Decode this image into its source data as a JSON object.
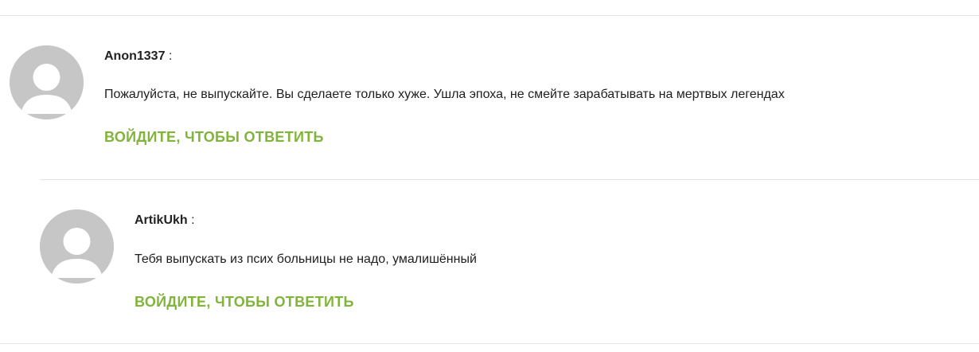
{
  "colors": {
    "accent": "#80b43a",
    "avatar_bg": "#c6c6c6",
    "divider": "#e4e4e4",
    "text": "#222222"
  },
  "comments": [
    {
      "author": "Anon1337",
      "separator": ":",
      "avatar_icon": "default-user-avatar-icon",
      "text": "Пожалуйста, не выпускайте. Вы сделаете только хуже. Ушла эпоха, не смейте зарабатывать на мертвых легендах",
      "reply_label": "ВОЙДИТЕ, ЧТОБЫ ОТВЕТИТЬ"
    },
    {
      "author": "ArtikUkh",
      "separator": ":",
      "avatar_icon": "default-user-avatar-icon",
      "text": "Тебя выпускать из псих больницы не надо, умалишённый",
      "reply_label": "ВОЙДИТЕ, ЧТОБЫ ОТВЕТИТЬ"
    }
  ]
}
